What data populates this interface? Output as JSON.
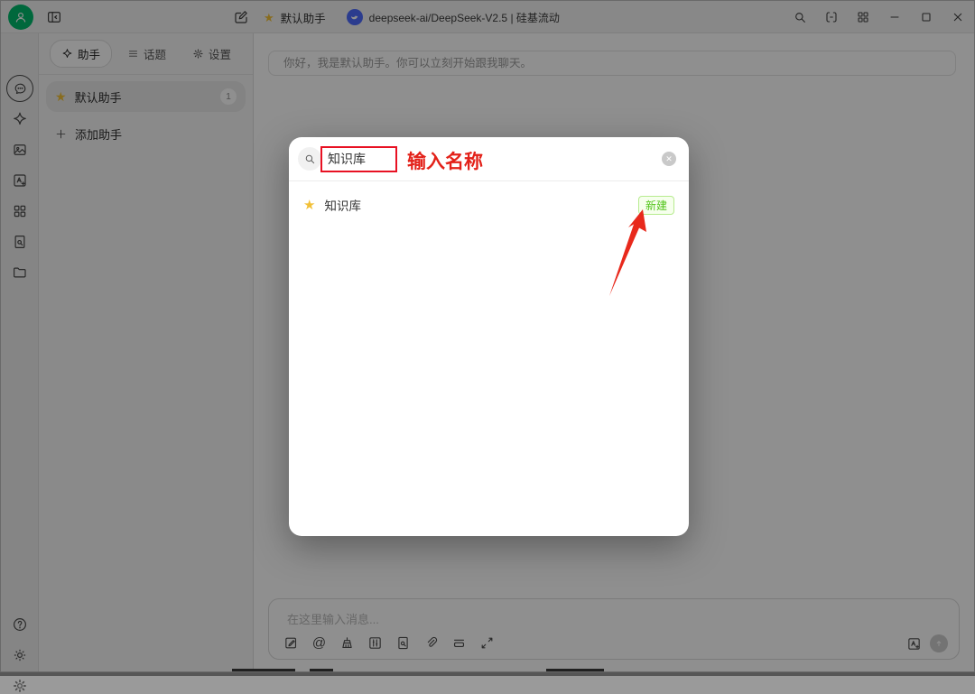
{
  "colors": {
    "accent_green": "#00b96b",
    "deepseek_blue": "#4d6bfe",
    "star_yellow": "#f2c037",
    "annotation_red": "#e81123",
    "tag_green_text": "#52c41a",
    "tag_green_border": "#b7eb8f",
    "tag_green_bg": "#f6ffed",
    "scrim": "rgba(0,0,0,0.44)"
  },
  "title_bar": {
    "assistant_label": "默认助手",
    "model_label": "deepseek-ai/DeepSeek-V2.5 | 硅基流动",
    "icons": [
      "user-avatar",
      "panel-toggle",
      "compose",
      "star",
      "deepseek-logo",
      "search",
      "compact-window",
      "app-grid",
      "minimize",
      "maximize",
      "close"
    ]
  },
  "icon_rail": {
    "icons": [
      "chat-bubble (active)",
      "sparkle",
      "image",
      "translate",
      "app-grid",
      "knowledge-search",
      "folder",
      "help",
      "theme-sun",
      "settings-gear"
    ]
  },
  "assistant_panel": {
    "tabs": [
      {
        "label": "助手",
        "icon": "sparkle-icon",
        "active": true
      },
      {
        "label": "话题",
        "icon": "list-icon",
        "active": false
      },
      {
        "label": "设置",
        "icon": "gear-icon",
        "active": false
      }
    ],
    "assistants": [
      {
        "label": "默认助手",
        "badge": "1",
        "starred": true,
        "active": true
      }
    ],
    "add_label": "添加助手"
  },
  "chat": {
    "greeting": "你好，我是默认助手。你可以立刻开始跟我聊天。",
    "input_placeholder": "在这里输入消息...",
    "toolbar_icons": [
      "new-topic",
      "mention",
      "clear-messages",
      "settings-sliders",
      "knowledge-search",
      "attachment",
      "clear-context",
      "expand",
      "translate",
      "send"
    ]
  },
  "modal": {
    "search": {
      "value": "知识库",
      "icon": "magnifier",
      "clear_icon": "circle-x"
    },
    "results": [
      {
        "label": "知识库",
        "starred": true,
        "action": "新建"
      }
    ]
  },
  "annotations": {
    "input_label": "输入名称",
    "shapes": [
      "red-box-around-input",
      "red-arrow-to-new-button"
    ]
  }
}
